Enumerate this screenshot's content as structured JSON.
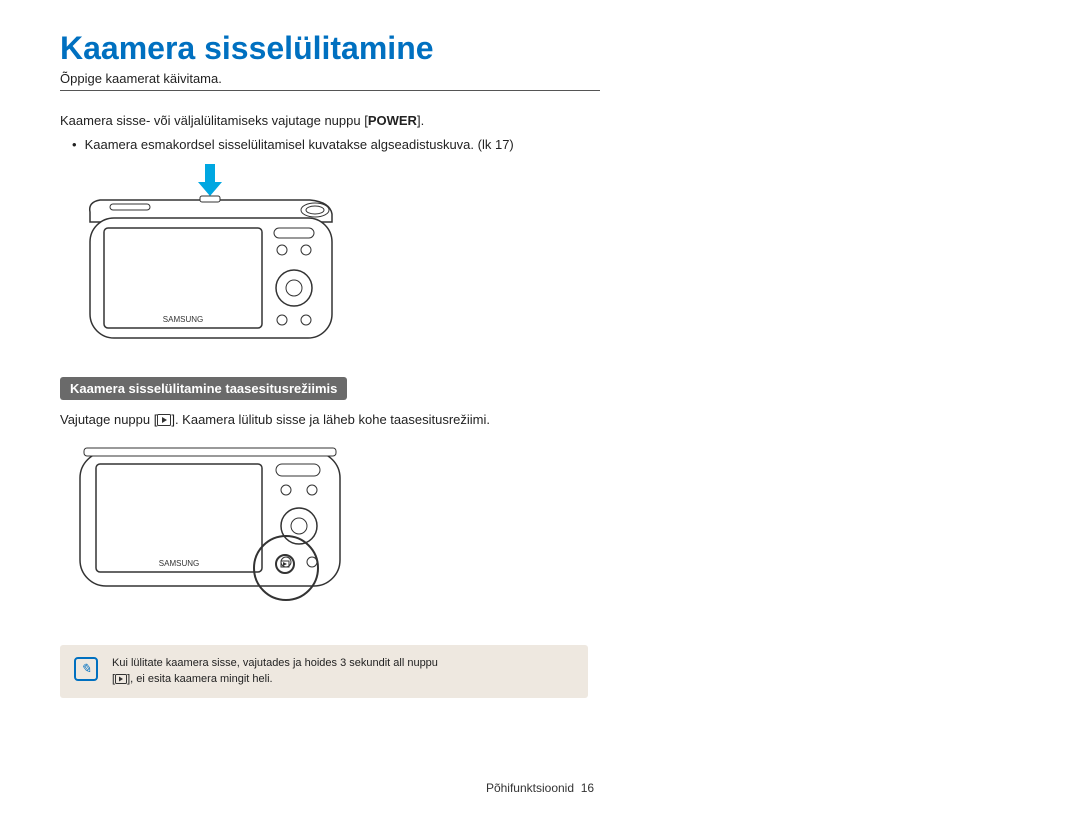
{
  "title": "Kaamera sisselülitamine",
  "subtitle": "Õppige kaamerat käivitama.",
  "intro": {
    "line_pre": "Kaamera sisse- või väljalülitamiseks vajutage nuppu [",
    "power": "POWER",
    "line_post": "].",
    "bullet": "Kaamera esmakordsel sisselülitamisel kuvatakse algseadistuskuva. (lk 17)"
  },
  "playback": {
    "label": "Kaamera sisselülitamine taasesitusrežiimis",
    "line_pre": "Vajutage nuppu [",
    "line_post": "]. Kaamera lülitub sisse ja läheb kohe taasesitusrežiimi."
  },
  "note": {
    "line1": "Kui lülitate kaamera sisse, vajutades ja hoides 3 sekundit all nuppu",
    "line2_pre": "[",
    "line2_post": "], ei esita kaamera mingit heli."
  },
  "footer": {
    "section": "Põhifunktsioonid",
    "page": "16"
  }
}
